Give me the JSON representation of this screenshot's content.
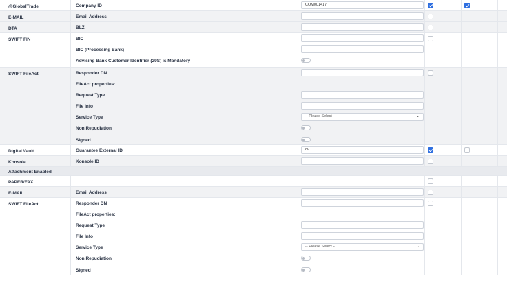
{
  "rows": {
    "global_trade": {
      "channel": "@GlobalTrade",
      "field": "Company ID",
      "value": "COM001417",
      "checked1": true,
      "checked2": true
    },
    "email_1": {
      "channel": "E-MAIL",
      "field": "Email Address",
      "value": ""
    },
    "dta": {
      "channel": "DTA",
      "field": "BLZ",
      "value": ""
    },
    "swift_fin": {
      "channel": "SWIFT FIN",
      "bic": "BIC",
      "bic_processing": "BIC (Processing Bank)",
      "advising_mandatory": "Advising Bank Customer Identifier (29S) is Mandatory"
    },
    "swift_fileact_1": {
      "channel": "SWIFT FileAct",
      "responder_dn": "Responder DN",
      "fileact_props": "FileAct properties:",
      "request_type": "Request Type",
      "file_info": "File Info",
      "service_type": "Service Type",
      "service_type_value": "-- Please Select --",
      "non_repudiation": "Non Repudiation",
      "signed": "Signed"
    },
    "digital_vault": {
      "channel": "Digital Vault",
      "field": "Guarantee External ID",
      "value": "dv",
      "checked1": true,
      "checked2": false
    },
    "konsole": {
      "channel": "Konsole",
      "field": "Konsole ID",
      "value": ""
    },
    "attachment_section": {
      "label": "Attachment Enabled"
    },
    "paper_fax": {
      "channel": "PAPER/FAX"
    },
    "email_2": {
      "channel": "E-MAIL",
      "field": "Email Address",
      "value": ""
    },
    "swift_fileact_2": {
      "channel": "SWIFT FileAct",
      "responder_dn": "Responder DN",
      "fileact_props": "FileAct properties:",
      "request_type": "Request Type",
      "file_info": "File Info",
      "service_type": "Service Type",
      "service_type_value": "-- Please Select --",
      "non_repudiation": "Non Repudiation",
      "signed": "Signed"
    }
  },
  "icons": {
    "dropdown": "chevron-down-icon",
    "checkbox_on": "checkbox-checked-icon"
  },
  "colors": {
    "accent": "#2f6fe0",
    "row_alt": "#f1f2f4",
    "border": "#e4e7ec"
  }
}
